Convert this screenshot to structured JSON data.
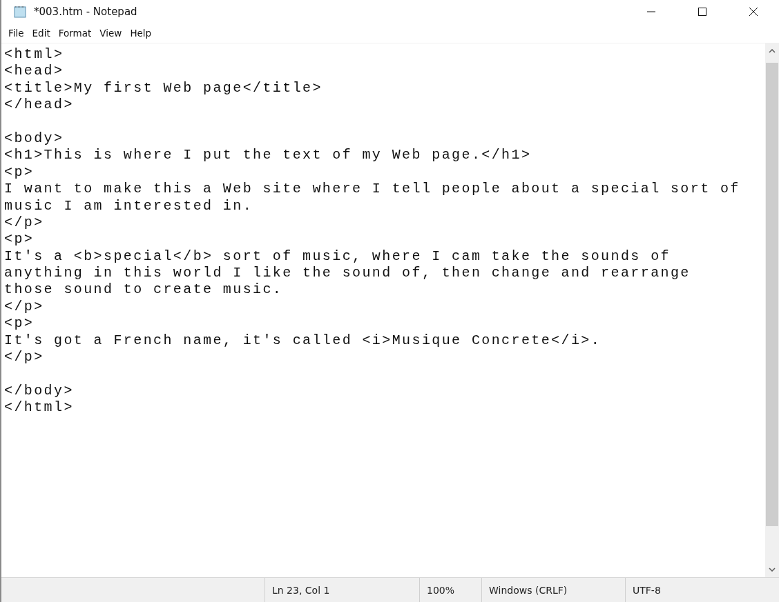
{
  "window": {
    "title": "*003.htm - Notepad"
  },
  "menu": [
    "File",
    "Edit",
    "Format",
    "View",
    "Help"
  ],
  "editor": {
    "lines": [
      {
        "kind": "text",
        "text": "<html>"
      },
      {
        "kind": "text",
        "text": "<head>"
      },
      {
        "kind": "text",
        "text": "<title>My first Web page</title>"
      },
      {
        "kind": "text",
        "text": "</head>"
      },
      {
        "kind": "blank"
      },
      {
        "kind": "text",
        "text": "<body>"
      },
      {
        "kind": "text",
        "text": "<h1>This is where I put the text of my Web page.</h1>"
      },
      {
        "kind": "text",
        "text": "<p>"
      },
      {
        "kind": "text",
        "text": "I want to make this a Web site where I tell people about a special sort of"
      },
      {
        "kind": "text",
        "text": "music I am interested in."
      },
      {
        "kind": "text",
        "text": "</p>"
      },
      {
        "kind": "text",
        "text": "<p>"
      },
      {
        "kind": "text",
        "text": "It's a <b>special</b> sort of music, where I cam take the sounds of"
      },
      {
        "kind": "text",
        "text": "anything in this world I like the sound of, then change and rearrange"
      },
      {
        "kind": "text",
        "text": "those sound to create music."
      },
      {
        "kind": "text",
        "text": "</p>"
      },
      {
        "kind": "text",
        "text": "<p>"
      },
      {
        "kind": "text",
        "text": "It's got a French name, it's called <i>Musique Concrete</i>."
      },
      {
        "kind": "text",
        "text": "</p>"
      },
      {
        "kind": "blank"
      },
      {
        "kind": "text",
        "text": "</body>"
      },
      {
        "kind": "text",
        "text": "</html>"
      }
    ]
  },
  "status_bar": [
    "Ln 23, Col 1",
    "100%",
    "Windows (CRLF)",
    "UTF-8"
  ]
}
